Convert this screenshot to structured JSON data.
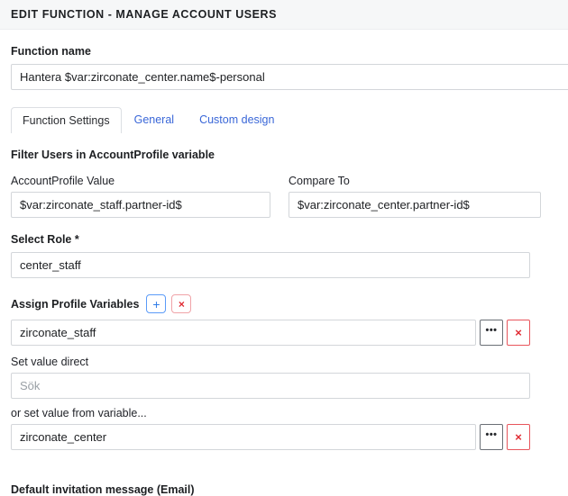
{
  "header": {
    "title": "EDIT FUNCTION - MANAGE ACCOUNT USERS"
  },
  "function_name": {
    "label": "Function name",
    "value": "Hantera $var:zirconate_center.name$-personal"
  },
  "tabs": [
    {
      "label": "Function Settings",
      "active": true
    },
    {
      "label": "General",
      "active": false
    },
    {
      "label": "Custom design",
      "active": false
    }
  ],
  "filter_section": {
    "heading": "Filter Users in AccountProfile variable",
    "account_profile": {
      "label": "AccountProfile Value",
      "value": "$var:zirconate_staff.partner-id$"
    },
    "compare_to": {
      "label": "Compare To",
      "value": "$var:zirconate_center.partner-id$"
    }
  },
  "select_role": {
    "label": "Select Role *",
    "value": "center_staff"
  },
  "assign_profile_variables": {
    "heading": "Assign Profile Variables",
    "add_button": "+",
    "remove_button": "×",
    "variable_row": {
      "value": "zirconate_staff",
      "browse_button": "•••",
      "delete_button": "×"
    },
    "set_value_direct": {
      "label": "Set value direct",
      "value": "",
      "placeholder": "Sök"
    },
    "set_value_from_variable": {
      "label": "or set value from variable...",
      "value": "zirconate_center",
      "browse_button": "•••",
      "delete_button": "×"
    }
  },
  "bottom_section": {
    "heading": "Default invitation message (Email)"
  },
  "colors": {
    "header_bg": "#f6f7f8",
    "link_blue": "#3a67d8",
    "danger_red": "#e02b33",
    "add_blue": "#2f7ce8",
    "border": "#d3d6da"
  }
}
